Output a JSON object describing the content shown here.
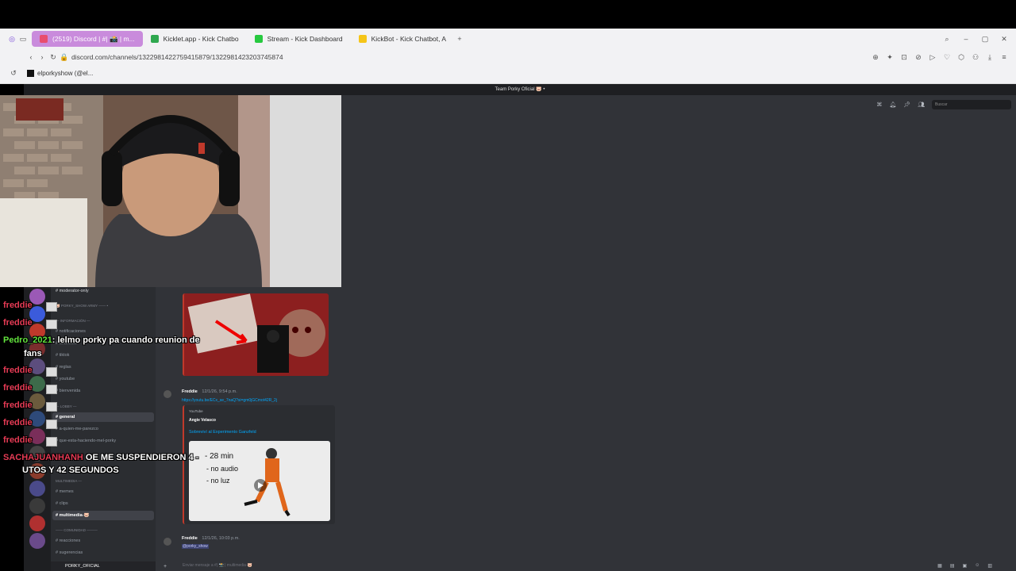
{
  "browser": {
    "tabs": [
      {
        "label": "(2519) Discord | #| 📸 | m...",
        "color": "#5865f2"
      },
      {
        "label": "Kicklet.app - Kick Chatbo",
        "color": "#2fa84f"
      },
      {
        "label": "Stream - Kick Dashboard",
        "color": "#27c93f"
      },
      {
        "label": "KickBot - Kick Chatbot, A",
        "color": "#f5c518"
      }
    ],
    "url": "discord.com/channels/1322981422759415879/1322981423203745874",
    "bookmark": "elporkyshow (@el..."
  },
  "discord": {
    "server_title": "Team Porky Oficial 🐷 •",
    "search_placeholder": "Buscar",
    "channels": [
      {
        "label": "moderator-only",
        "kind": "channel"
      },
      {
        "label": "🐷 PORKY_SHOW ARMY —— •",
        "kind": "category"
      },
      {
        "label": "— INFORMACIÓN —",
        "kind": "category"
      },
      {
        "label": "notificaciones",
        "kind": "channel"
      },
      {
        "label": "anuncios",
        "kind": "channel"
      },
      {
        "label": "tiktok",
        "kind": "channel"
      },
      {
        "label": "reglas",
        "kind": "channel"
      },
      {
        "label": "youtube",
        "kind": "channel"
      },
      {
        "label": "bienvenida",
        "kind": "channel"
      },
      {
        "label": "— LOBBY —",
        "kind": "category"
      },
      {
        "label": "general",
        "kind": "active"
      },
      {
        "label": "a-quien-me-parezco",
        "kind": "channel"
      },
      {
        "label": "que-esta-haciendo-mel-porky",
        "kind": "channel"
      },
      {
        "label": "MULTIMEDIA —",
        "kind": "category"
      },
      {
        "label": "memes",
        "kind": "channel"
      },
      {
        "label": "clips",
        "kind": "channel"
      },
      {
        "label": "multimedia-🐷",
        "kind": "active"
      },
      {
        "label": "—— COMUNIDAD ———",
        "kind": "category"
      },
      {
        "label": "reacciones",
        "kind": "channel"
      },
      {
        "label": "sugerencias",
        "kind": "channel"
      }
    ],
    "user_panel": "PORKY_OFICIAL",
    "message1": {
      "author": "Freddie",
      "timestamp": "12/1/26, 9:54 p.m.",
      "link": "https://youtu.be/ECx_se_7naQ?si=gm0jGCmot42R_2j",
      "embed_provider": "YouTube",
      "embed_author": "Angie Velasco",
      "embed_title": "Sobreviví al Experimento Ganzfeld",
      "thumb_lines": [
        "- 28 min",
        "- no audio",
        "- no luz"
      ]
    },
    "message2": {
      "author": "Freddie",
      "timestamp": "12/1/26, 10:03 p.m.",
      "text": "@porky_show"
    },
    "composer": "Enviar mensaje a #| 📸 | multimedia-🐷"
  },
  "stream_chat": {
    "lines": [
      {
        "name": "freddie",
        "text": ""
      },
      {
        "name": "freddie",
        "text": ""
      },
      {
        "name": "Pedro_2021",
        "text": ": lelmo porky pa cuando reunion de",
        "green": true
      },
      {
        "name": "",
        "text": "fans"
      },
      {
        "name": "freddie",
        "text": ""
      },
      {
        "name": "freddie",
        "text": ""
      },
      {
        "name": "freddie",
        "text": ""
      },
      {
        "name": "freddie",
        "text": ""
      },
      {
        "name": "freddie",
        "text": ""
      },
      {
        "name": "SACHAJUANHANH",
        "text": " OE ME SUSPENDIERON 4 -"
      },
      {
        "name": "",
        "text": "UTOS Y 42 SEGUNDOS"
      }
    ]
  }
}
